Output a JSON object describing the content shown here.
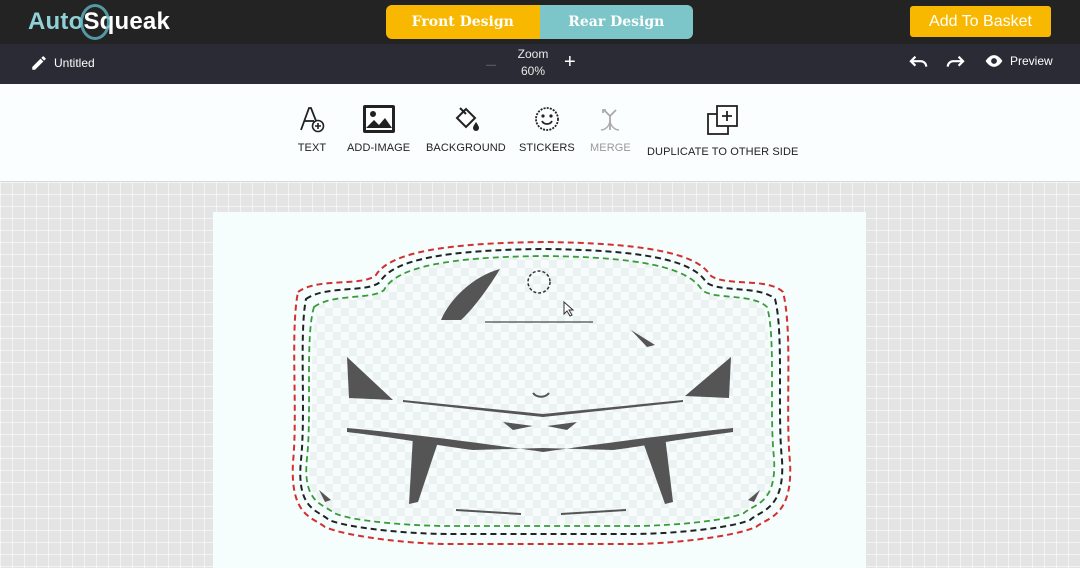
{
  "logo": {
    "part1": "Auto",
    "part2": "Squeak"
  },
  "design_tabs": {
    "front": "Front Design",
    "rear": "Rear Design"
  },
  "header": {
    "basket_label": "Add To Basket"
  },
  "subbar": {
    "title": "Untitled",
    "zoom_label": "Zoom",
    "zoom_value": "60%",
    "zoom_minus": "–",
    "zoom_plus": "+",
    "preview_label": "Preview"
  },
  "tools": [
    {
      "label": "TEXT",
      "icon": "text-add-icon"
    },
    {
      "label": "ADD-IMAGE",
      "icon": "image-icon"
    },
    {
      "label": "BACKGROUND",
      "icon": "paint-bucket-icon"
    },
    {
      "label": "STICKERS",
      "icon": "smiley-icon"
    },
    {
      "label": "MERGE",
      "icon": "merge-icon",
      "disabled": true
    },
    {
      "label": "DUPLICATE TO OTHER SIDE",
      "icon": "duplicate-icon"
    }
  ],
  "colors": {
    "accent": "#f9b800",
    "teal": "#7cc5c9",
    "topbar": "#232323",
    "subbar": "#2b2b36",
    "cut_red": "#d32f2f",
    "cut_green": "#3a9a3a",
    "cut_black": "#222222",
    "car_grey": "#555555"
  }
}
